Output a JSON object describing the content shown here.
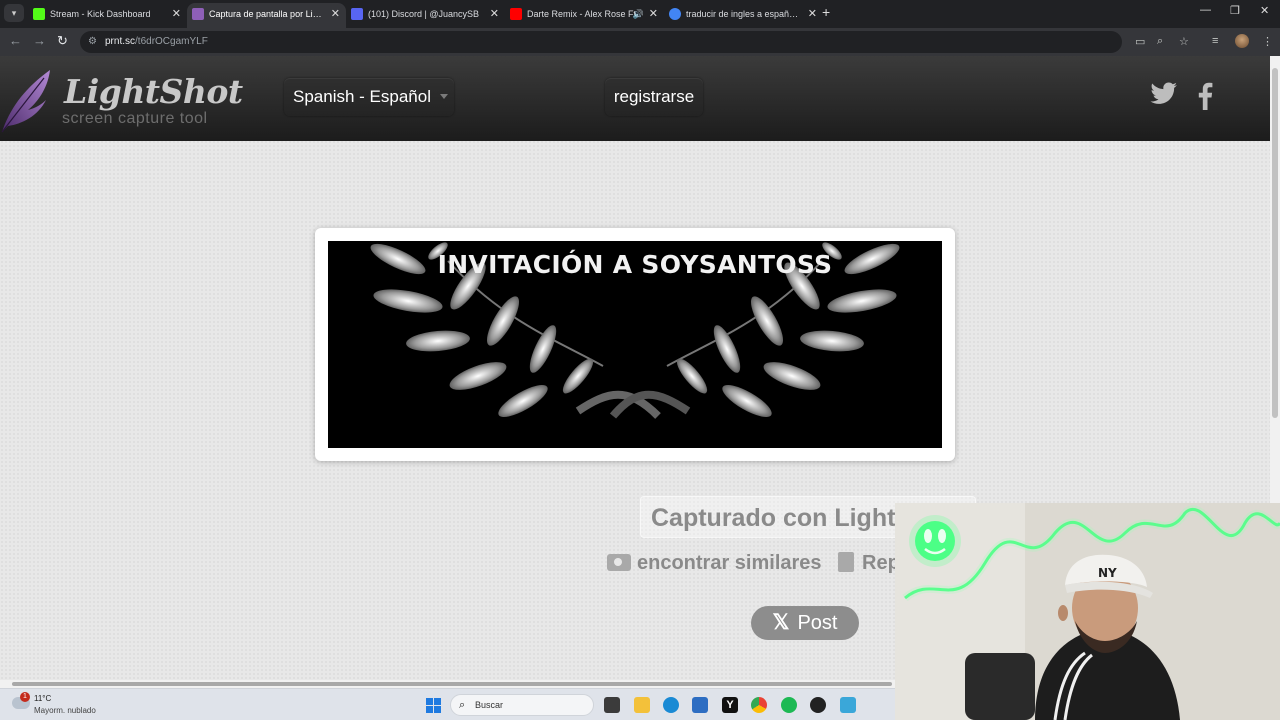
{
  "browser": {
    "tabs": [
      {
        "title": "Stream - Kick Dashboard",
        "active": false,
        "favicon_color": "#53fc18"
      },
      {
        "title": "Captura de pantalla por Lightsh",
        "active": true,
        "favicon_color": "#8e5fb8"
      },
      {
        "title": "(101) Discord | @JuancySB",
        "active": false,
        "favicon_color": "#5865f2"
      },
      {
        "title": "Darte Remix - Alex Rose Ft.",
        "active": false,
        "favicon_color": "#ff0000"
      },
      {
        "title": "traducir de ingles a español - B",
        "active": false,
        "favicon_color": "#4285f4"
      }
    ],
    "url_host": "prnt.sc",
    "url_path": "/t6drOCgamYLF"
  },
  "site": {
    "logo_title": "LightShot",
    "logo_subtitle": "screen capture tool",
    "language_label": "Spanish - Español",
    "register_label": "registrarse"
  },
  "screenshot": {
    "caption": "INVITACIÓN A SOYSANTOSS"
  },
  "actions": {
    "captured_label": "Capturado con Lightshot",
    "similar_label": "encontrar similares",
    "report_label": "Reportar",
    "post_label": "Post"
  },
  "taskbar": {
    "temperature": "11°C",
    "weather": "Mayorm. nublado",
    "search_placeholder": "Buscar",
    "weather_badge": "1"
  },
  "icons": {
    "twitter": "twitter-icon",
    "facebook": "facebook-icon",
    "camera": "camera-icon",
    "report": "clipboard-icon",
    "x_logo": "x-logo-icon"
  },
  "colors": {
    "header_bg": "#2a2a2a",
    "page_bg": "#e8e8e8",
    "browser_bg": "#202124",
    "neon_green": "#3dff7a"
  }
}
